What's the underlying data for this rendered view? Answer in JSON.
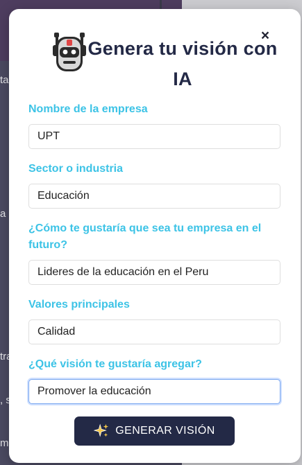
{
  "modal": {
    "title": "Genera tu visión con IA",
    "close_label": "×"
  },
  "fields": [
    {
      "label": "Nombre de la empresa",
      "value": "UPT"
    },
    {
      "label": "Sector o industria",
      "value": "Educación"
    },
    {
      "label": "¿Cómo te gustaría que sea tu empresa en el futuro?",
      "value": "Lideres de la educación en el Peru"
    },
    {
      "label": "Valores principales",
      "value": "Calidad"
    },
    {
      "label": "¿Qué visión te gustaría agregar?",
      "value": "Promover la educación"
    }
  ],
  "generate_button": {
    "label": "GENERAR VISIÓN",
    "icon": "sparkle-icon"
  },
  "background": {
    "fragments": [
      "ta",
      "a",
      "tra",
      ", s",
      "m"
    ]
  },
  "colors": {
    "title": "#232946",
    "label": "#3cc3e6",
    "button_bg": "#232946",
    "button_text": "#ffffff",
    "focus_border": "#7aa7ef"
  },
  "icons": {
    "header": "robot-icon",
    "close": "close-icon"
  }
}
